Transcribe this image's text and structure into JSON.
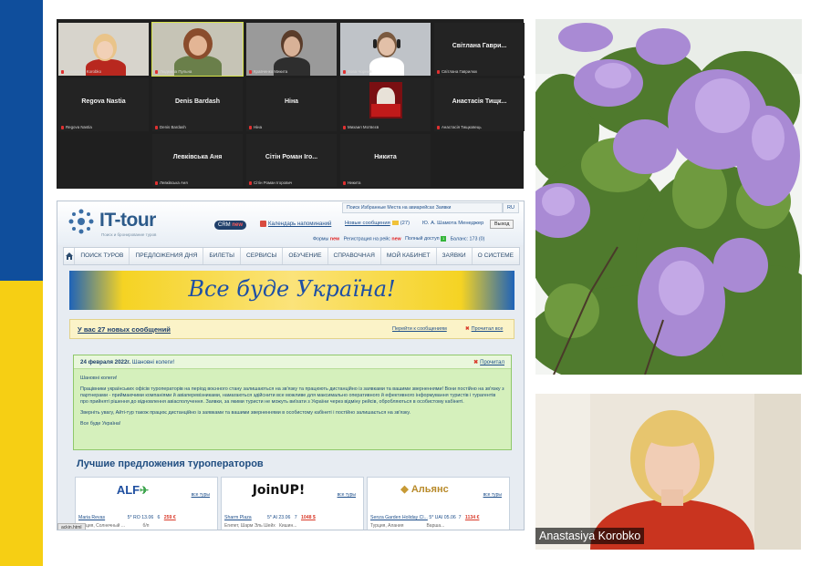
{
  "colors": {
    "flag_blue": "#0f4e9c",
    "flag_yellow": "#f6cf14",
    "site_blue": "#2c5a8a",
    "notice_green": "#d5f0bc"
  },
  "zoom": {
    "participants": [
      {
        "big": "",
        "small": "Anastasiya Korobko",
        "video": true
      },
      {
        "big": "",
        "small": "Людмила Пульна",
        "video": true,
        "active": true
      },
      {
        "big": "",
        "small": "Кравченко Микита",
        "video": true
      },
      {
        "big": "",
        "small": "Вова Чорний",
        "video": true
      },
      {
        "big": "Світлана Гаври...",
        "small": "Світлана Гаврилюк",
        "video": false
      },
      {
        "big": "Regova Nastia",
        "small": "Regova Nastia",
        "video": false
      },
      {
        "big": "Denis Bardash",
        "small": "Denis Bardash",
        "video": false
      },
      {
        "big": "Ніна",
        "small": "Ніна",
        "video": false
      },
      {
        "big": "",
        "small": "Михаил Мотвєєв",
        "video": true,
        "red": true
      },
      {
        "big": "Анастасія Тищк...",
        "small": "Анастасія Тищковець",
        "video": false
      },
      {
        "big": "Левківська Аня",
        "small": "Левківська Аня",
        "video": false
      },
      {
        "big": "Сітін Роман Іго...",
        "small": "Сітін Роман Ігорович",
        "video": false
      },
      {
        "big": "Никита",
        "small": "Никита",
        "video": false
      }
    ]
  },
  "speaker": {
    "name": "Anastasiya Korobko"
  },
  "site": {
    "logo": "IT-tour",
    "logo_sub": "Поиск и бронирование туров",
    "crm": "CRM",
    "crm_new": "new",
    "calendar": "Календарь напоминаний",
    "top_links": "Поиск  Избранные  Места на авиарейсах  Заявки",
    "lang": "RU",
    "messages": "Новые сообщения",
    "messages_count": "(27)",
    "user": "Ю. А. Шамота Менеджер",
    "logout": "Выход",
    "forms": "Формы",
    "forms_new": "new",
    "registration": "Регистрация на рейс",
    "registration_new": "new",
    "full_access": "Полный доступ",
    "full_access_badge": "1",
    "balance": "Баланс: 173 (0)",
    "nav": [
      "ПОИСК ТУРОВ",
      "ПРЕДЛОЖЕНИЯ ДНЯ",
      "БИЛЕТЫ",
      "СЕРВИСЫ",
      "ОБУЧЕНИЕ",
      "СПРАВОЧНАЯ",
      "МОЙ КАБИНЕТ",
      "ЗАЯВКИ",
      "О СИСТЕМЕ"
    ],
    "banner": "Все буде Україна!",
    "msgbar_title": "У вас 27 новых сообщений",
    "msgbar_go": "Перейти к сообщениям",
    "msgbar_read": "Прочитал все",
    "notice_date": "24 февраля 2022г.",
    "notice_subject": "Шановні колеги!",
    "notice_read": "Прочитал",
    "notice_p1": "Шановні колеги!",
    "notice_p2": "Працівники українських офісів туроператорів на період воєнного стану залишаються на зв'язку та працюють дистанційно із заявками та вашими зверненнями! Вони постійно на зв'язку з партнерами - приймаючими компаніями й авіаперевізниками, намагаються здійснити все можливе для максимально оперативного й ефективного інформування туристів і турагентів про прийняті рішення до відновлення авіасполучення. Заявки, за якими туристи не можуть виїхати з України через відміну рейсів, обробляються в особистому кабінеті.",
    "notice_p3": "Зверніть увагу, Айті-тур також працює дистанційно із заявками та вашими зверненнями в особистому кабінеті і постійно залишається на зв'язку.",
    "notice_p4": "Все буде Україна!",
    "offers_title": "Лучшие предложения туроператоров",
    "offers": [
      {
        "logo": "ALF",
        "all": "все туры",
        "hotel": "Maria Revas",
        "stars": "5*",
        "board": "RO",
        "date": "13.06",
        "nights": "6",
        "price": "259 €",
        "place": "Греция, Солнечный ...",
        "extra": "б/п"
      },
      {
        "logo": "JoinUP!",
        "all": "все туры",
        "hotel": "Sharm Plaza",
        "stars": "5*",
        "board": "AI",
        "date": "23.06",
        "nights": "7",
        "price": "1048 $",
        "place": "Египет, Шарм Эль Шейх",
        "extra": "Кишин..."
      },
      {
        "logo": "Альянс",
        "all": "все туры",
        "hotel": "Senza Garden Holiday Cl...",
        "stars": "5*",
        "board": "UAI",
        "date": "05.06",
        "nights": "7",
        "price": "1134 €",
        "place": "Турция, Алания",
        "extra": "Варша..."
      }
    ],
    "status_url": "ackin.html"
  }
}
